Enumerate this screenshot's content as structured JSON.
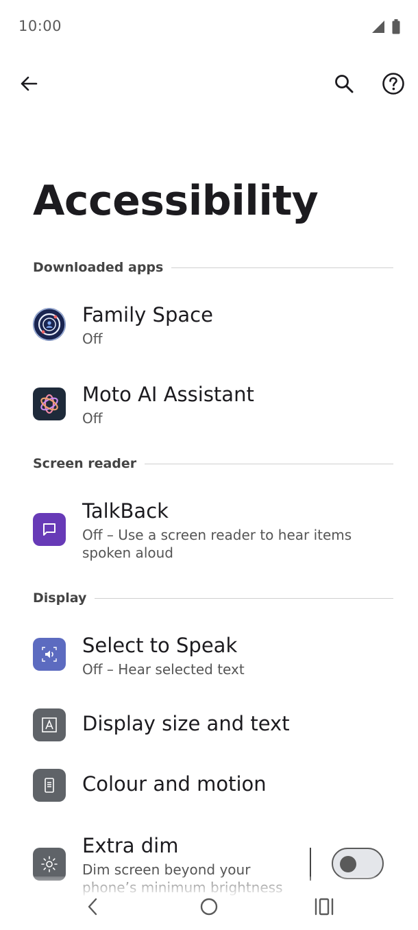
{
  "status_bar": {
    "time": "10:00"
  },
  "page": {
    "title": "Accessibility"
  },
  "sections": [
    {
      "label": "Downloaded apps"
    },
    {
      "label": "Screen reader"
    },
    {
      "label": "Display"
    }
  ],
  "items": {
    "family_space": {
      "title": "Family Space",
      "summary": "Off"
    },
    "moto_ai": {
      "title": "Moto AI Assistant",
      "summary": "Off"
    },
    "talkback": {
      "title": "TalkBack",
      "summary": "Off – Use a screen reader to hear items spoken aloud"
    },
    "select_to_speak": {
      "title": "Select to Speak",
      "summary": "Off – Hear selected text"
    },
    "display_size": {
      "title": "Display size and text"
    },
    "colour_motion": {
      "title": "Colour and motion"
    },
    "extra_dim": {
      "title": "Extra dim",
      "summary": "Dim screen beyond your phone’s minimum brightness",
      "enabled": false
    }
  },
  "colors": {
    "talkback_icon": "#673ab7",
    "select_to_speak_icon": "#5c6bc0",
    "gray_icon": "#5f6368",
    "family_space_icon": "#1a2550",
    "moto_ai_icon": "#1e2a3a"
  },
  "icons": {
    "back": "arrow-back-icon",
    "search": "search-icon",
    "help": "help-icon"
  }
}
